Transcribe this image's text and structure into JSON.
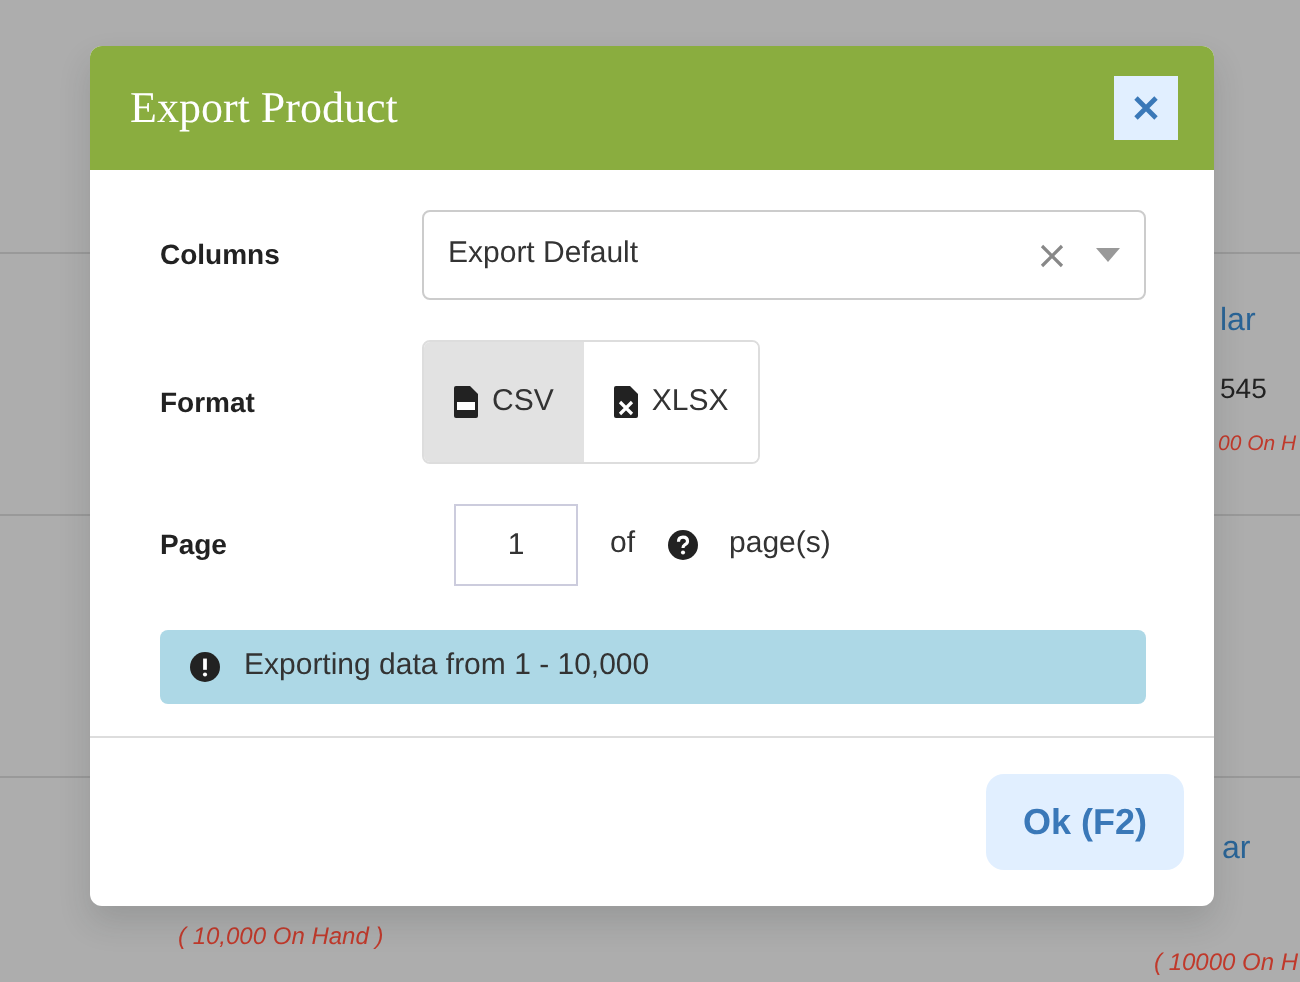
{
  "background": {
    "texts": [
      {
        "text": "lar",
        "kind": "link"
      },
      {
        "text": "545",
        "kind": "plain"
      },
      {
        "text": "00 On H",
        "kind": "stock"
      },
      {
        "text": "ar",
        "kind": "link"
      },
      {
        "text": "( 10,000 On Hand )",
        "kind": "stock"
      },
      {
        "text": "( 10000 On H",
        "kind": "stock"
      }
    ]
  },
  "dialog": {
    "title": "Export Product",
    "fields": [
      {
        "label": "Columns",
        "kind": "select",
        "value": "Export Default"
      },
      {
        "label": "Format",
        "kind": "toggle",
        "options": [
          {
            "label": "CSV",
            "selected": true
          },
          {
            "label": "XLSX",
            "selected": false
          }
        ]
      },
      {
        "label": "Page",
        "kind": "page",
        "value": "1",
        "of": "of",
        "suffix": "page(s)"
      }
    ],
    "alert": "Exporting data from 1 - 10,000",
    "buttons": [
      "Ok (F2)"
    ]
  }
}
